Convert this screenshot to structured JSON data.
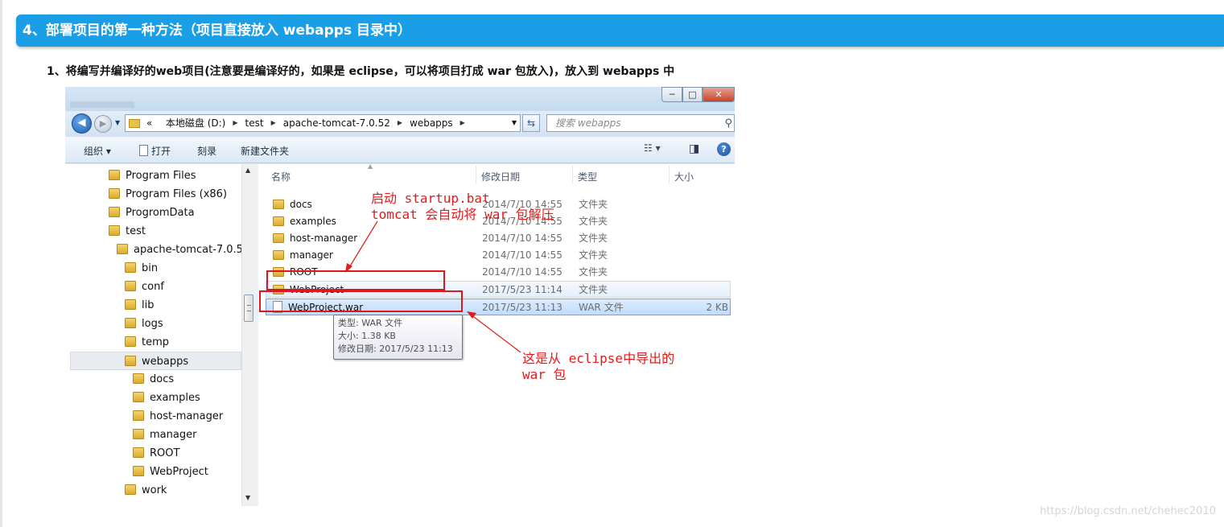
{
  "heading": "4、部署项目的第一种方法（项目直接放入 webapps 目录中）",
  "step_text": "1、将编写并编译好的web项目(注意要是编译好的，如果是 eclipse，可以将项目打成 war 包放入)，放入到 webapps 中",
  "explorer": {
    "window_buttons": {
      "minimize": "─",
      "maximize": "□",
      "close": "✕"
    },
    "address": {
      "prefix": "«",
      "crumbs": [
        "本地磁盘 (D:)",
        "test",
        "apache-tomcat-7.0.52",
        "webapps"
      ]
    },
    "search_placeholder": "搜索 webapps",
    "toolbar": {
      "organize": "组织 ▾",
      "open": "打开",
      "burn": "刻录",
      "new_folder": "新建文件夹"
    },
    "tree": [
      "Program Files",
      "Program Files (x86)",
      "ProgromData",
      "test",
      "apache-tomcat-7.0.52",
      "bin",
      "conf",
      "lib",
      "logs",
      "temp",
      "webapps",
      "docs",
      "examples",
      "host-manager",
      "manager",
      "ROOT",
      "WebProject",
      "work"
    ],
    "columns": {
      "name": "名称",
      "date": "修改日期",
      "type": "类型",
      "size": "大小"
    },
    "files": [
      {
        "name": "docs",
        "date": "2014/7/10 14:55",
        "type": "文件夹",
        "size": ""
      },
      {
        "name": "examples",
        "date": "2014/7/10 14:55",
        "type": "文件夹",
        "size": ""
      },
      {
        "name": "host-manager",
        "date": "2014/7/10 14:55",
        "type": "文件夹",
        "size": ""
      },
      {
        "name": "manager",
        "date": "2014/7/10 14:55",
        "type": "文件夹",
        "size": ""
      },
      {
        "name": "ROOT",
        "date": "2014/7/10 14:55",
        "type": "文件夹",
        "size": ""
      },
      {
        "name": "WebProject",
        "date": "2017/5/23 11:14",
        "type": "文件夹",
        "size": ""
      },
      {
        "name": "WebProject.war",
        "date": "2017/5/23 11:13",
        "type": "WAR 文件",
        "size": "2 KB"
      }
    ],
    "tooltip": {
      "type": "类型: WAR 文件",
      "size": "大小: 1.38 KB",
      "modified": "修改日期: 2017/5/23 11:13"
    }
  },
  "annotations": {
    "top_line1": "启动 startup.bat",
    "top_line2": "tomcat 会自动将 war 包解压",
    "bottom_line1": "这是从 eclipse中导出的",
    "bottom_line2": "war 包",
    "color": "#e11b1b"
  },
  "watermark": "https://blog.csdn.net/chehec2010"
}
